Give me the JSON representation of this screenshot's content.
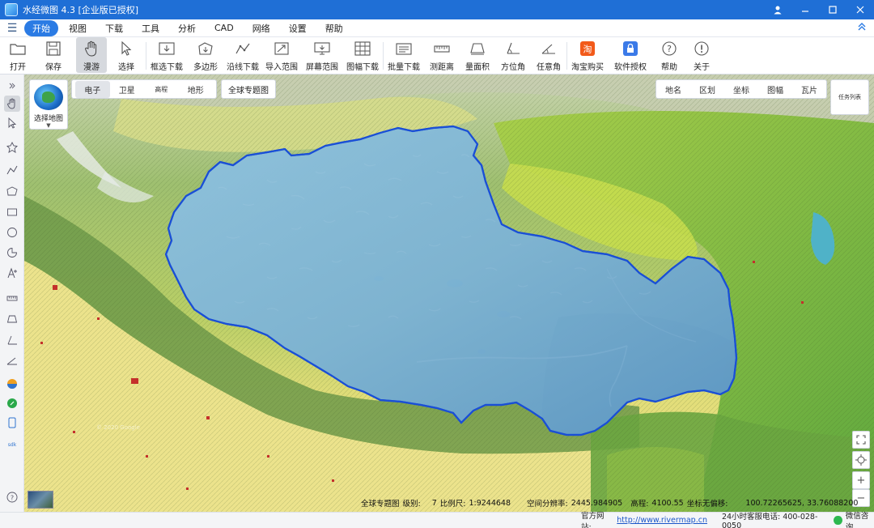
{
  "window": {
    "title": "水经微图 4.3 [企业版已授权]",
    "buttons": [
      "user-icon",
      "minimize-icon",
      "restore-icon",
      "close-icon"
    ]
  },
  "menu": {
    "items": [
      "开始",
      "视图",
      "下载",
      "工具",
      "分析",
      "CAD",
      "网络",
      "设置",
      "帮助"
    ],
    "active": "开始"
  },
  "toolbar": {
    "tools": [
      {
        "label": "打开",
        "icon": "folder-icon"
      },
      {
        "label": "保存",
        "icon": "save-icon"
      },
      {
        "label": "漫游",
        "icon": "hand-icon",
        "selected": true
      },
      {
        "label": "选择",
        "icon": "cursor-icon"
      },
      {
        "label": "框选下载",
        "icon": "box-download-icon"
      },
      {
        "label": "多边形",
        "icon": "polygon-icon"
      },
      {
        "label": "沿线下载",
        "icon": "line-download-icon"
      },
      {
        "label": "导入范围",
        "icon": "import-range-icon"
      },
      {
        "label": "屏幕范围",
        "icon": "screen-range-icon"
      },
      {
        "label": "图幅下载",
        "icon": "sheet-download-icon"
      },
      {
        "label": "批量下载",
        "icon": "batch-download-icon"
      },
      {
        "label": "测距离",
        "icon": "ruler-icon"
      },
      {
        "label": "量面积",
        "icon": "area-icon"
      },
      {
        "label": "方位角",
        "icon": "azimuth-icon"
      },
      {
        "label": "任意角",
        "icon": "angle-icon"
      },
      {
        "label": "淘宝购买",
        "icon": "taobao-icon"
      },
      {
        "label": "软件授权",
        "icon": "license-icon"
      },
      {
        "label": "帮助",
        "icon": "help-icon"
      },
      {
        "label": "关于",
        "icon": "info-icon"
      }
    ]
  },
  "map": {
    "selector_label": "选择地图",
    "layer_tabs": [
      "电子",
      "卫星",
      "高程",
      "地形"
    ],
    "active_layer": "电子",
    "global_topic": "全球专题图",
    "right_tabs": [
      "地名",
      "区划",
      "坐标",
      "图幅",
      "瓦片"
    ],
    "task_list": "任务列表",
    "watermark": "© 2020 Google"
  },
  "status": {
    "map_type": "全球专题图",
    "level_label": "级别:",
    "level": "7",
    "scale_label": "比例尺:",
    "scale": "1:9244648",
    "resolution_label": "空间分辨率:",
    "resolution": "2445.984905",
    "elevation_label": "高程:",
    "elevation": "4100.55",
    "coord_label": "坐标无偏移:",
    "coords": "100.72265625, 33.76088200"
  },
  "footer": {
    "site_label": "官方网站:",
    "site_url": "http://www.rivermap.cn",
    "phone": "24小时客服电话: 400-028-0050",
    "wechat": "微信咨询"
  },
  "colors": {
    "titlebar": "#1f6fd6",
    "active_menu": "#2b7be4",
    "boundary": "#1a4fd6",
    "highlight_fill": "#5aa8d8"
  }
}
